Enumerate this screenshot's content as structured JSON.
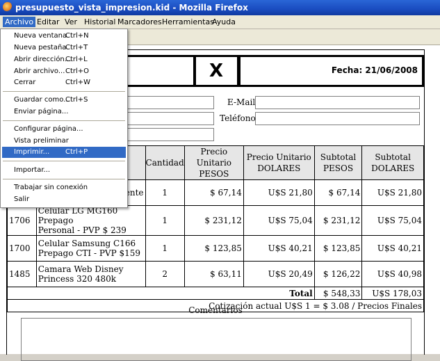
{
  "window": {
    "title": "presupuesto_vista_impresion.kid - Mozilla Firefox"
  },
  "menubar": [
    "Archivo",
    "Editar",
    "Ver",
    "Historial",
    "Marcadores",
    "Herramientas",
    "Ayuda"
  ],
  "file_menu": {
    "items": [
      {
        "label": "Nueva ventana",
        "shortcut": "Ctrl+N"
      },
      {
        "label": "Nueva pestaña",
        "shortcut": "Ctrl+T"
      },
      {
        "label": "Abrir dirección...",
        "shortcut": "Ctrl+L"
      },
      {
        "label": "Abrir archivo...",
        "shortcut": "Ctrl+O"
      },
      {
        "label": "Cerrar",
        "shortcut": "Ctrl+W"
      },
      {
        "label": "Guardar como...",
        "shortcut": "Ctrl+S"
      },
      {
        "label": "Enviar página...",
        "shortcut": ""
      },
      {
        "label": "Configurar página...",
        "shortcut": ""
      },
      {
        "label": "Vista preliminar",
        "shortcut": ""
      },
      {
        "label": "Imprimir...",
        "shortcut": "Ctrl+P"
      },
      {
        "label": "Importar...",
        "shortcut": ""
      },
      {
        "label": "Trabajar sin conexión",
        "shortcut": ""
      },
      {
        "label": "Salir",
        "shortcut": ""
      }
    ],
    "highlighted": "Imprimir..."
  },
  "page": {
    "doc_type": "X",
    "fecha": "Fecha: 21/06/2008",
    "email_label": "E-Mail",
    "telefono_label": "Teléfono",
    "table": {
      "headers": {
        "cantidad": "Cantidad",
        "precio_pesos": [
          "Precio Unitario",
          "PESOS"
        ],
        "precio_dolares": [
          "Precio Unitario",
          "DOLARES"
        ],
        "subtotal_pesos": [
          "Subtotal",
          "PESOS"
        ],
        "subtotal_dolares": [
          "Subtotal",
          "DOLARES"
        ]
      },
      "rows": [
        {
          "code": "",
          "desc": [
            "ente",
            ""
          ],
          "qty": "1",
          "pu_pesos": "$ 67,14",
          "pu_usd": "U$S 21,80",
          "st_pesos": "$ 67,14",
          "st_usd": "U$S 21,80"
        },
        {
          "code": "1706",
          "desc": [
            "Celular LG MG160 Prepago",
            "Personal - PVP $ 239"
          ],
          "qty": "1",
          "pu_pesos": "$ 231,12",
          "pu_usd": "U$S 75,04",
          "st_pesos": "$ 231,12",
          "st_usd": "U$S 75,04"
        },
        {
          "code": "1700",
          "desc": [
            "Celular Samsung C166",
            "Prepago CTI - PVP $159"
          ],
          "qty": "1",
          "pu_pesos": "$ 123,85",
          "pu_usd": "U$S 40,21",
          "st_pesos": "$ 123,85",
          "st_usd": "U$S 40,21"
        },
        {
          "code": "1485",
          "desc": [
            "Camara Web Disney",
            "Princess 320 480k"
          ],
          "qty": "2",
          "pu_pesos": "$ 63,11",
          "pu_usd": "U$S 20,49",
          "st_pesos": "$ 126,22",
          "st_usd": "U$S 40,98"
        }
      ],
      "total_label": "Total",
      "total_pesos": "$ 548,33",
      "total_usd": "U$S 178,03",
      "cotizacion": "Cotización actual U$S 1 = $ 3.08 / Precios Finales"
    },
    "comentarios_label": "Comentarios"
  }
}
